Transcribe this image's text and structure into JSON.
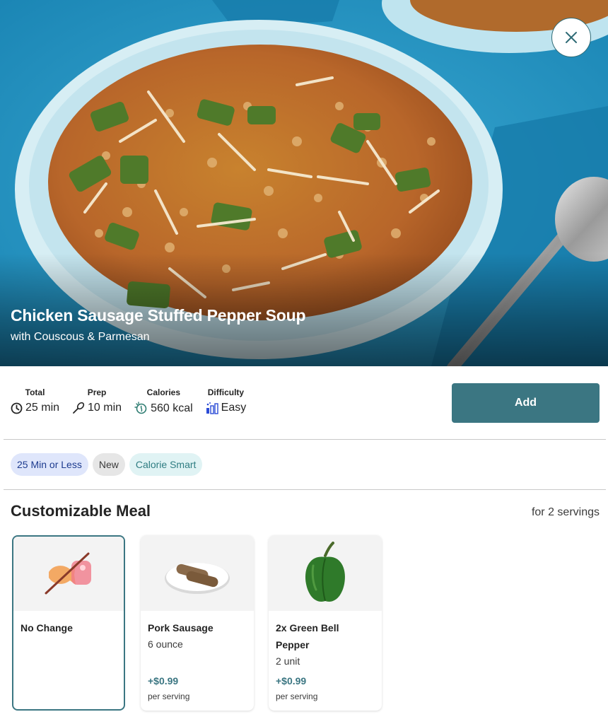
{
  "recipe": {
    "title": "Chicken Sausage Stuffed Pepper Soup",
    "subtitle": "with Couscous & Parmesan"
  },
  "stats": [
    {
      "label": "Total",
      "value": "25 min",
      "icon": "clock-icon"
    },
    {
      "label": "Prep",
      "value": "10 min",
      "icon": "whisk-icon"
    },
    {
      "label": "Calories",
      "value": "560 kcal",
      "icon": "calories-icon"
    },
    {
      "label": "Difficulty",
      "value": "Easy",
      "icon": "difficulty-bars-icon"
    }
  ],
  "actions": {
    "add_label": "Add",
    "close_icon": "close-icon"
  },
  "tags": [
    {
      "label": "25 Min or Less"
    },
    {
      "label": "New"
    },
    {
      "label": "Calorie Smart"
    }
  ],
  "customize": {
    "title": "Customizable Meal",
    "servings": "for 2 servings",
    "options": [
      {
        "name": "No Change",
        "icon": "no-change-icon"
      },
      {
        "name": "Pork Sausage",
        "qty": "6 ounce",
        "price": "+$0.99",
        "per": "per serving",
        "icon": "sausage-icon"
      },
      {
        "name": "2x Green Bell Pepper",
        "qty": "2 unit",
        "price": "+$0.99",
        "per": "per serving",
        "icon": "green-pepper-icon"
      }
    ]
  },
  "colors": {
    "primary": "#3b7682",
    "hero_background": "#2a9dc9"
  }
}
